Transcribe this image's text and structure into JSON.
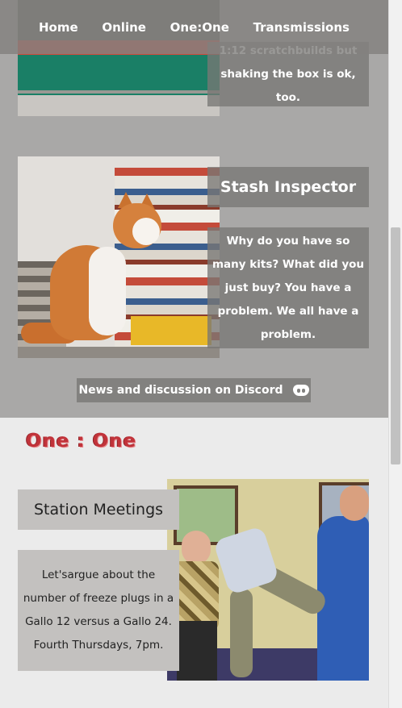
{
  "nav": {
    "items": [
      "Home",
      "Online",
      "One:One",
      "Transmissions"
    ]
  },
  "cards": {
    "scratchbuilds": {
      "body": "1:12 scratchbuilds but shaking the box is ok, too."
    },
    "stash": {
      "title": "Stash Inspector",
      "body": "Why do you have so many kits? What did you just buy? You have a problem. We all have a problem."
    },
    "meetings": {
      "title": "Station Meetings",
      "body": "Let'sargue about the number of freeze plugs in a Gallo 12 versus a Gallo 24. Fourth Thursdays, 7pm."
    }
  },
  "discord": {
    "label": "News and discussion on Discord",
    "icon": "discord-icon"
  },
  "sections": {
    "one_one": "One : One"
  },
  "colors": {
    "top_background": "#a9a8a7",
    "bottom_background": "#ebebeb",
    "panel_dark": "#787775",
    "panel_light": "#c3c1bf",
    "heading_red": "#c1333a"
  }
}
